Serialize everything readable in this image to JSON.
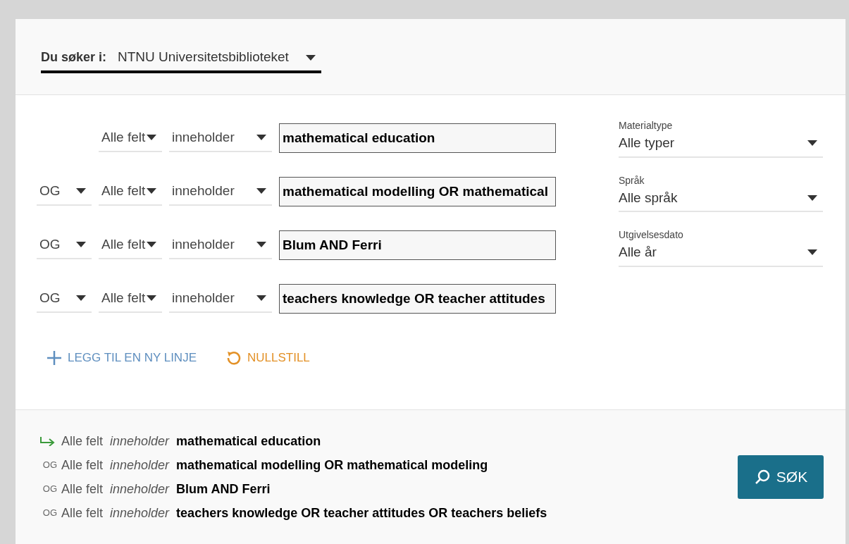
{
  "scope": {
    "label": "Du søker i:",
    "value": "NTNU Universitetsbiblioteket"
  },
  "rows": [
    {
      "field": "Alle felt",
      "condition": "inneholder",
      "value": "mathematical education"
    },
    {
      "operator": "OG",
      "field": "Alle felt",
      "condition": "inneholder",
      "value": "mathematical modelling OR mathematical"
    },
    {
      "operator": "OG",
      "field": "Alle felt",
      "condition": "inneholder",
      "value": "Blum AND Ferri"
    },
    {
      "operator": "OG",
      "field": "Alle felt",
      "condition": "inneholder",
      "value": "teachers knowledge OR teacher attitudes"
    }
  ],
  "filters": [
    {
      "label": "Materialtype",
      "value": "Alle typer"
    },
    {
      "label": "Språk",
      "value": "Alle språk"
    },
    {
      "label": "Utgivelsesdato",
      "value": "Alle år"
    }
  ],
  "actions": {
    "add_line": "LEGG TIL EN NY LINJE",
    "reset": "NULLSTILL"
  },
  "summary": [
    {
      "field": "Alle felt",
      "condition": "inneholder",
      "value": "mathematical education"
    },
    {
      "operator": "OG",
      "field": "Alle felt",
      "condition": "inneholder",
      "value": "mathematical modelling OR mathematical modeling"
    },
    {
      "operator": "OG",
      "field": "Alle felt",
      "condition": "inneholder",
      "value": "Blum AND Ferri"
    },
    {
      "operator": "OG",
      "field": "Alle felt",
      "condition": "inneholder",
      "value": "teachers knowledge OR teacher attitudes OR teachers beliefs"
    }
  ],
  "search_button": "SØK"
}
